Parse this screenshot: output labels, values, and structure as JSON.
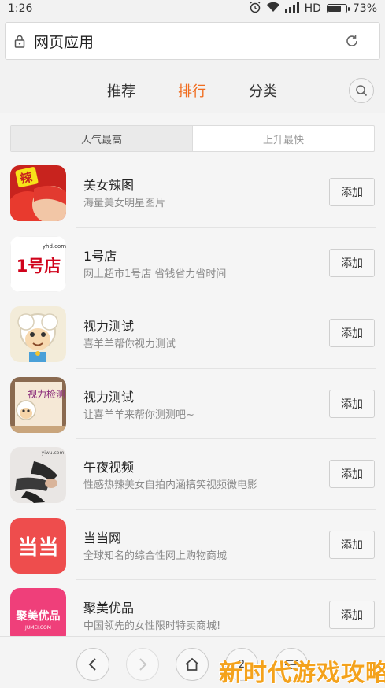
{
  "status_bar": {
    "time": "1:26",
    "network": "HD",
    "battery": "73%",
    "battery_level": 0.73
  },
  "address_bar": {
    "title": "网页应用"
  },
  "tabs": [
    {
      "label": "推荐",
      "active": false
    },
    {
      "label": "排行",
      "active": true
    },
    {
      "label": "分类",
      "active": false
    }
  ],
  "segments": [
    {
      "label": "人气最高",
      "active": true
    },
    {
      "label": "上升最快",
      "active": false
    }
  ],
  "apps": [
    {
      "name": "美女辣图",
      "desc": "海量美女明星图片",
      "button": "添加",
      "icon_text": "辣"
    },
    {
      "name": "1号店",
      "desc": "网上超市1号店 省钱省力省时间",
      "button": "添加",
      "icon_text": "1号店",
      "icon_subtext": "yhd.com"
    },
    {
      "name": "视力测试",
      "desc": "喜羊羊帮你视力测试",
      "button": "添加"
    },
    {
      "name": "视力测试",
      "desc": "让喜羊羊来帮你测测吧~",
      "button": "添加",
      "icon_text": "视力检测"
    },
    {
      "name": "午夜视频",
      "desc": "性感热辣美女自拍内涵搞笑视频微电影",
      "button": "添加",
      "icon_subtext": "yiwu.com"
    },
    {
      "name": "当当网",
      "desc": "全球知名的综合性网上购物商城",
      "button": "添加",
      "icon_text": "当当"
    },
    {
      "name": "聚美优品",
      "desc": "中国领先的女性限时特卖商城!",
      "button": "添加",
      "icon_text": "聚美优品",
      "icon_subtext": "JUMEI.COM"
    }
  ],
  "bottom_nav": {
    "tabs_count": "2"
  },
  "watermark": "新时代游戏攻略",
  "colors": {
    "accent": "#f06c1e",
    "dangdang": "#ee4d4d",
    "jumei": "#ef3f7a"
  }
}
